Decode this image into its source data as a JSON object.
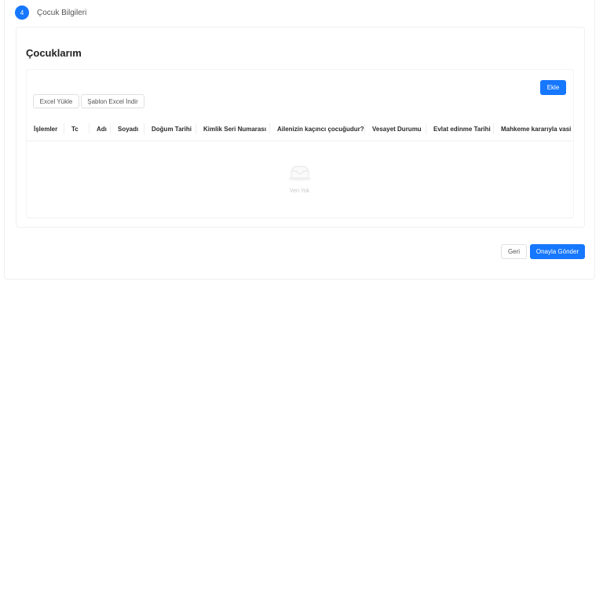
{
  "step": {
    "number": "4",
    "title": "Çocuk Bilgileri"
  },
  "section": {
    "title": "Çocuklarım"
  },
  "toolbar": {
    "add_label": "Ekle",
    "excel_upload_label": "Excel Yükle",
    "template_download_label": "Şablon Excel İndir"
  },
  "table": {
    "columns": [
      "İşlemler",
      "Tc",
      "Adı",
      "Soyadı",
      "Doğum Tarihi",
      "Kimlik Seri Numarası",
      "Ailenizin kaçıncı çocuğudur?",
      "Vesayet Durumu",
      "Evlat edinme Tarihi",
      "Mahkeme kararıyla vasi"
    ],
    "rows": [],
    "empty_text": "Veri Yok"
  },
  "footer": {
    "back_label": "Geri",
    "submit_label": "Onayla Gönder"
  },
  "colors": {
    "primary": "#1677ff"
  },
  "icons": {
    "empty": "empty-inbox-icon"
  }
}
